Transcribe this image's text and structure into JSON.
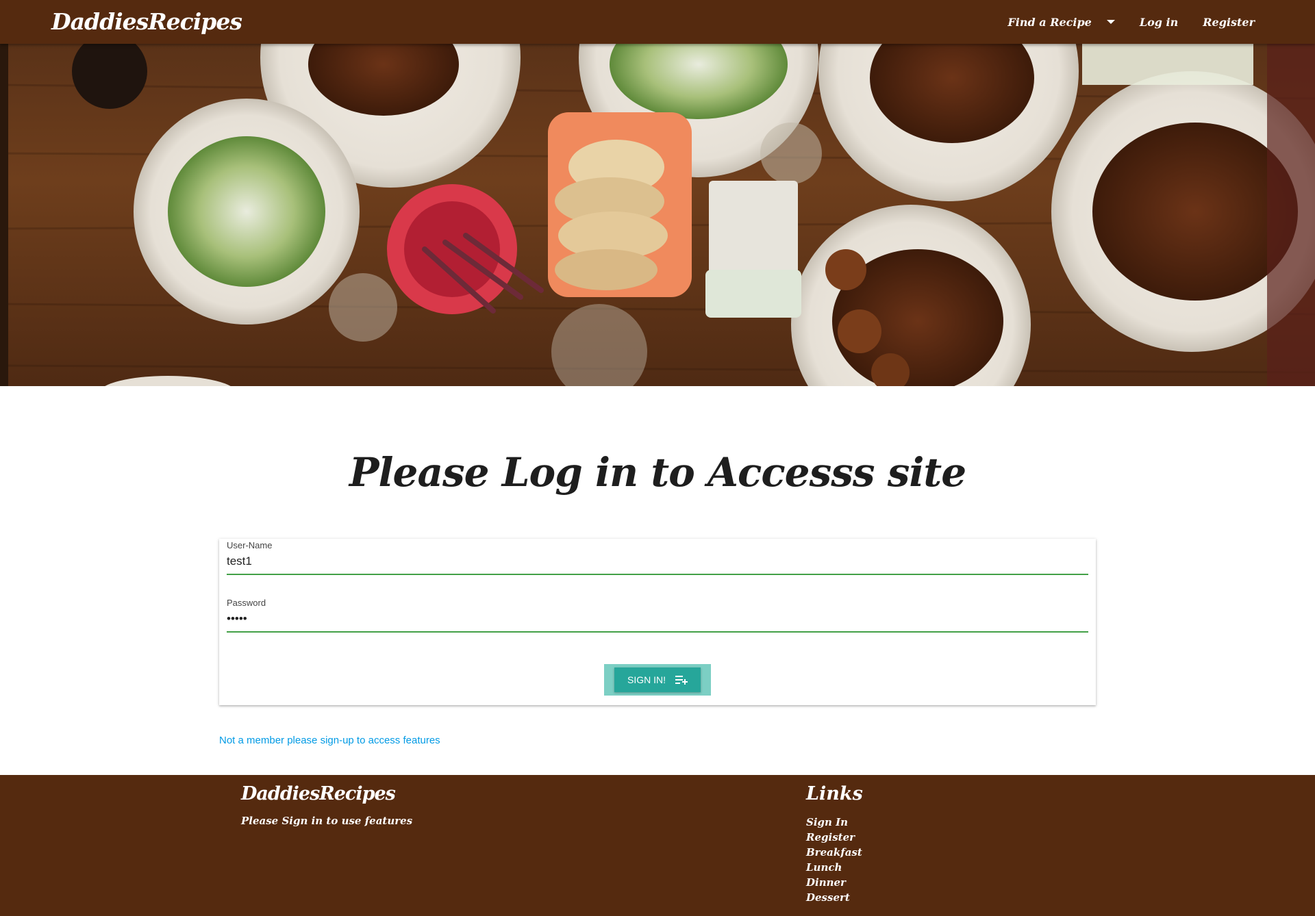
{
  "navbar": {
    "brand": "DaddiesRecipes",
    "links": [
      {
        "label": "Find a Recipe",
        "dropdown": true
      },
      {
        "label": "Log in"
      },
      {
        "label": "Register"
      }
    ]
  },
  "hero": {
    "image": "food-table-photo"
  },
  "main": {
    "title": "Please Log in to Accesss site",
    "username": {
      "label": "User-Name",
      "value": "test1"
    },
    "password": {
      "label": "Password",
      "value": "•••••"
    },
    "sign_in_button": {
      "label": "SIGN IN!",
      "icon": "playlist-add-icon"
    },
    "signup_link": "Not a member please sign-up to access features"
  },
  "footer": {
    "title": "DaddiesRecipes",
    "subtitle": "Please Sign in to use features",
    "links_title": "Links",
    "links": [
      "Sign In",
      "Register",
      "Breakfast",
      "Lunch",
      "Dinner",
      "Dessert"
    ]
  },
  "colors": {
    "nav_bg": "#552a0f",
    "button": "#26a69a",
    "input_underline": "#43a047",
    "link": "#039be5"
  }
}
